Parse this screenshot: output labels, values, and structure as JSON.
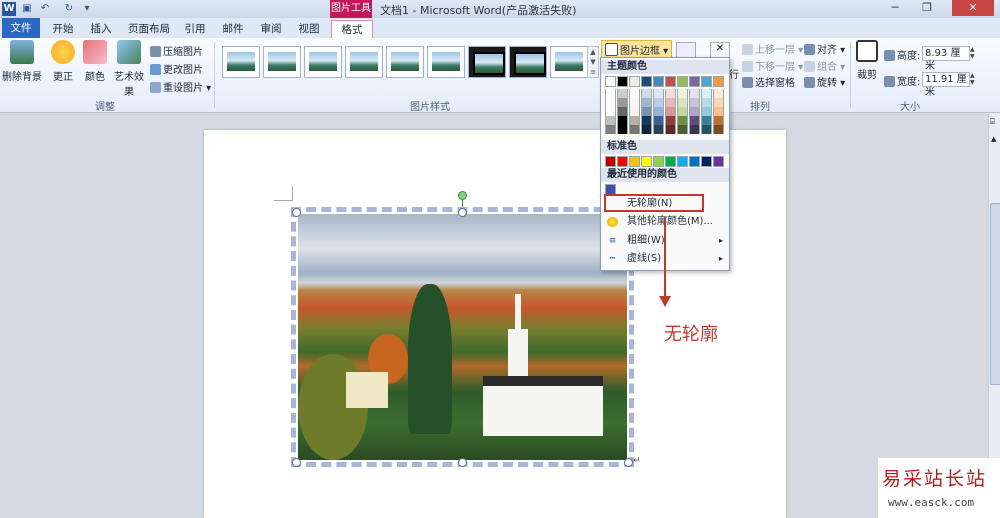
{
  "window": {
    "title": "文档1 - Microsoft Word(产品激活失败)",
    "context_tools": "图片工具",
    "word_logo": "W"
  },
  "tabs": [
    {
      "label": "文件"
    },
    {
      "label": "开始"
    },
    {
      "label": "插入"
    },
    {
      "label": "页面布局"
    },
    {
      "label": "引用"
    },
    {
      "label": "邮件"
    },
    {
      "label": "审阅"
    },
    {
      "label": "视图"
    },
    {
      "label": "格式"
    }
  ],
  "ribbon": {
    "adjust": {
      "remove_bg": "删除背景",
      "correct": "更正",
      "color": "颜色",
      "art_effect": "艺术效果",
      "compress": "压缩图片",
      "change": "更改图片",
      "reset": "重设图片",
      "group_label": "调整"
    },
    "styles": {
      "group_label": "图片样式"
    },
    "picture_border": "图片边框",
    "arrange": {
      "bring_forward": "上移一层",
      "send_backward": "下移一层",
      "selection_pane": "选择窗格",
      "align": "对齐",
      "group": "组合",
      "rotate": "旋转",
      "row": "行",
      "group_label": "排列"
    },
    "size": {
      "crop": "裁剪",
      "height_label": "高度:",
      "height_value": "8.93 厘米",
      "width_label": "宽度:",
      "width_value": "11.91 厘米",
      "group_label": "大小"
    }
  },
  "dropdown": {
    "theme_colors": "主题颜色",
    "standard_colors": "标准色",
    "recent_colors": "最近使用的颜色",
    "no_outline": "无轮廓(N)",
    "more_colors": "其他轮廓颜色(M)...",
    "weight": "粗细(W)",
    "dashes": "虚线(S)",
    "theme_top_row": [
      "#ffffff",
      "#000000",
      "#eeece1",
      "#1f497d",
      "#4f81bd",
      "#c0504d",
      "#9bbb59",
      "#8064a2",
      "#4bacc6",
      "#f79646"
    ],
    "standard_row": [
      "#c00000",
      "#ff0000",
      "#ffc000",
      "#ffff00",
      "#92d050",
      "#00b050",
      "#00b0f0",
      "#0070c0",
      "#002060",
      "#7030a0"
    ],
    "recent": [
      "#3f51b5"
    ]
  },
  "annotation": "无轮廓",
  "watermark": {
    "title": "易采站长站",
    "url": "www.easck.com"
  }
}
